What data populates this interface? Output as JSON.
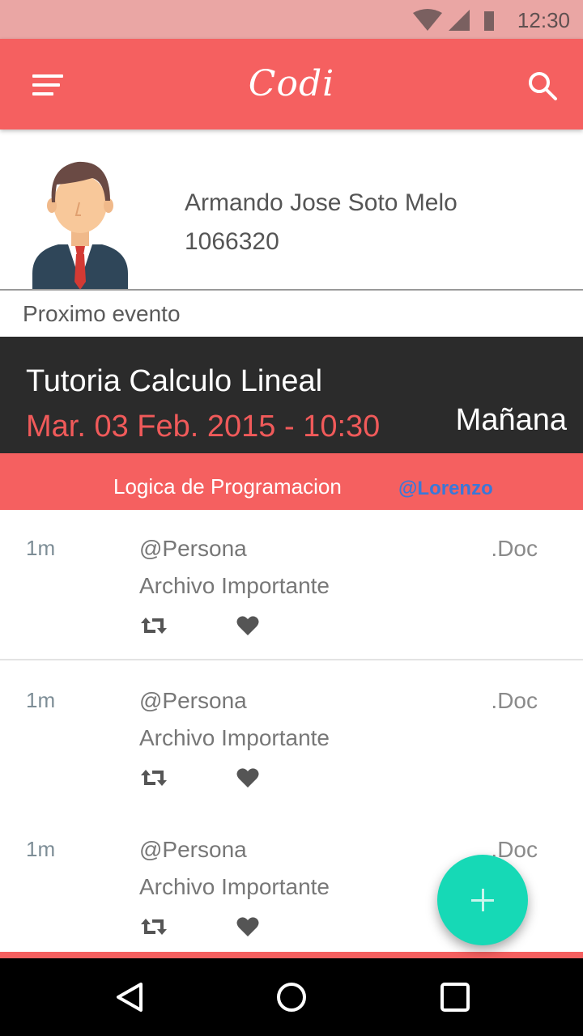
{
  "status_bar": {
    "time": "12:30"
  },
  "app_bar": {
    "title": "Codi",
    "icons": [
      "menu-icon",
      "search-icon"
    ]
  },
  "profile": {
    "name": "Armando Jose Soto Melo",
    "id": "1066320"
  },
  "section_label": "Proximo evento",
  "event": {
    "title": "Tutoria Calculo Lineal",
    "date": "Mar. 03 Feb. 2015 - 10:30",
    "when": "Mañana"
  },
  "course": {
    "name": "Logica de Programacion",
    "user": "@Lorenzo"
  },
  "feed": [
    {
      "time": "1m",
      "user": "@Persona",
      "description": "Archivo Importante",
      "ext": ".Doc"
    },
    {
      "time": "1m",
      "user": "@Persona",
      "description": "Archivo Importante",
      "ext": ".Doc"
    },
    {
      "time": "1m",
      "user": "@Persona",
      "description": "Archivo Importante",
      "ext": ".Doc"
    }
  ],
  "colors": {
    "accent": "#f56060",
    "dark": "#2b2b2b",
    "fab": "#16d9b6",
    "status_bar": "#eaa6a4",
    "link": "#3a78d8"
  }
}
